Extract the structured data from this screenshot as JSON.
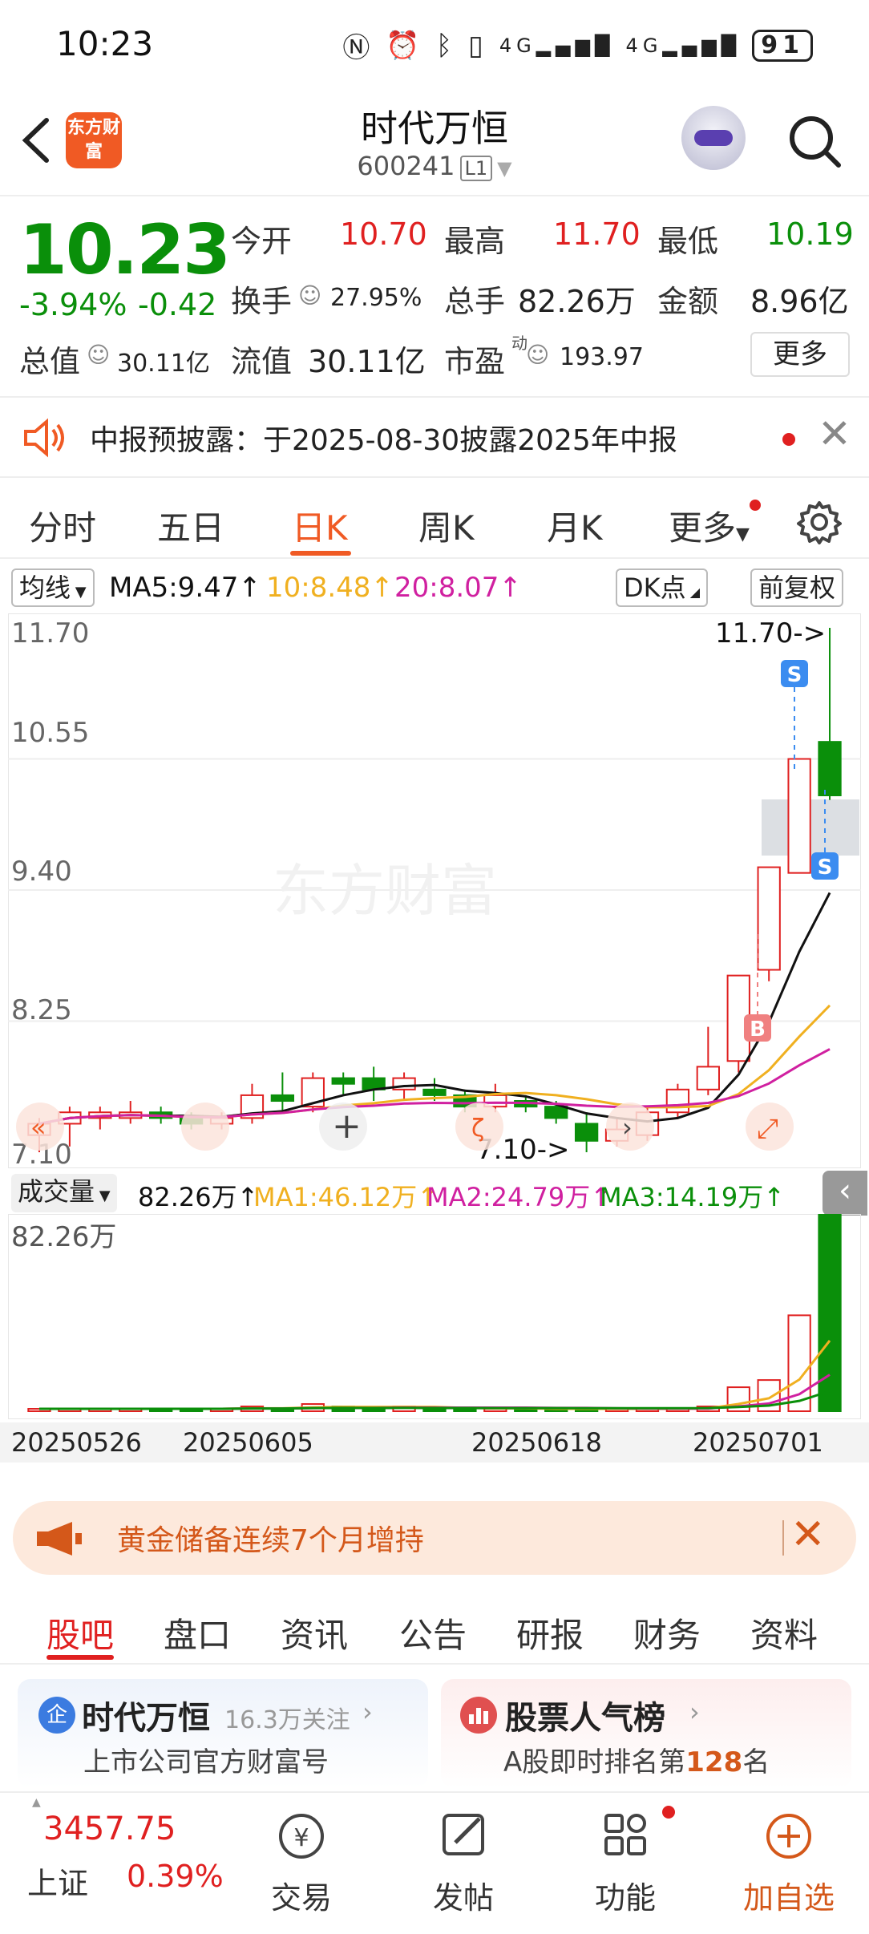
{
  "status": {
    "time": "10:23",
    "battery": "91"
  },
  "header": {
    "app_logo": "东方财富",
    "stock_name": "时代万恒",
    "stock_code": "600241",
    "level": "L1"
  },
  "quote": {
    "price": "10.23",
    "pct_change": "-3.94%",
    "abs_change": "-0.42",
    "open_label": "今开",
    "open": "10.70",
    "high_label": "最高",
    "high": "11.70",
    "low_label": "最低",
    "low": "10.19",
    "turnover_label": "换手",
    "turnover": "27.95%",
    "volume_label": "总手",
    "volume": "82.26万",
    "amount_label": "金额",
    "amount": "8.96亿",
    "mktcap_label": "总值",
    "mktcap": "30.11亿",
    "float_label": "流值",
    "float_cap": "30.11亿",
    "pe_label": "市盈",
    "pe_sup": "动",
    "pe": "193.97",
    "more": "更多"
  },
  "notice": {
    "text": "中报预披露：于2025-08-30披露2025年中报"
  },
  "chart_tabs": [
    "分时",
    "五日",
    "日K",
    "周K",
    "月K",
    "更多"
  ],
  "ma_row": {
    "selector": "均线",
    "ma5": "MA5:9.47↑",
    "ma10": "10:8.48↑",
    "ma20": "20:8.07↑",
    "dk": "DK点",
    "adjust": "前复权"
  },
  "kline": {
    "y_labels": [
      "11.70",
      "10.55",
      "9.40",
      "8.25",
      "7.10"
    ],
    "high_marker": "11.70->",
    "low_marker": "7.10->",
    "watermark": "东方财富",
    "sell_mark": "S",
    "buy_mark": "B"
  },
  "volume": {
    "selector": "成交量",
    "vol": "82.26万↑",
    "ma1": "MA1:46.12万↑",
    "ma2": "MA2:24.79万↑",
    "ma3": "MA3:14.19万↑",
    "axis_label": "82.26万"
  },
  "dates": [
    "20250526",
    "20250605",
    "20250618",
    "20250701"
  ],
  "banner": {
    "text": "黄金储备连续7个月增持"
  },
  "bottom_tabs": [
    "股吧",
    "盘口",
    "资讯",
    "公告",
    "研报",
    "财务",
    "资料"
  ],
  "card_left": {
    "title": "时代万恒",
    "follow": "16.3万关注",
    "sub": "上市公司官方财富号"
  },
  "card_right": {
    "title": "股票人气榜",
    "sub_pre": "A股即时排名第",
    "rank": "128",
    "sub_post": "名"
  },
  "bottom_nav": {
    "index_value": "3457.75",
    "index_name": "上证",
    "index_pct": "0.39%",
    "trade": "交易",
    "post": "发帖",
    "func": "功能",
    "add": "加自选"
  },
  "colors": {
    "up": "#e02020",
    "down": "#0a8f0a",
    "accent": "#f05a24",
    "ma5": "#111111",
    "ma10": "#f0b020",
    "ma20": "#d020a0"
  },
  "chart_data": {
    "type": "candlestick",
    "ylim": [
      7.1,
      11.7
    ],
    "candles": [
      {
        "o": 7.25,
        "c": 7.35,
        "h": 7.4,
        "l": 7.1
      },
      {
        "o": 7.35,
        "c": 7.45,
        "h": 7.5,
        "l": 7.15
      },
      {
        "o": 7.4,
        "c": 7.45,
        "h": 7.5,
        "l": 7.3
      },
      {
        "o": 7.4,
        "c": 7.45,
        "h": 7.55,
        "l": 7.35
      },
      {
        "o": 7.45,
        "c": 7.4,
        "h": 7.5,
        "l": 7.35
      },
      {
        "o": 7.4,
        "c": 7.35,
        "h": 7.45,
        "l": 7.3
      },
      {
        "o": 7.35,
        "c": 7.4,
        "h": 7.45,
        "l": 7.3
      },
      {
        "o": 7.4,
        "c": 7.6,
        "h": 7.7,
        "l": 7.35
      },
      {
        "o": 7.6,
        "c": 7.55,
        "h": 7.8,
        "l": 7.45
      },
      {
        "o": 7.5,
        "c": 7.75,
        "h": 7.8,
        "l": 7.45
      },
      {
        "o": 7.75,
        "c": 7.7,
        "h": 7.8,
        "l": 7.6
      },
      {
        "o": 7.75,
        "c": 7.65,
        "h": 7.85,
        "l": 7.55
      },
      {
        "o": 7.65,
        "c": 7.75,
        "h": 7.8,
        "l": 7.55
      },
      {
        "o": 7.65,
        "c": 7.6,
        "h": 7.75,
        "l": 7.55
      },
      {
        "o": 7.6,
        "c": 7.5,
        "h": 7.65,
        "l": 7.45
      },
      {
        "o": 7.5,
        "c": 7.6,
        "h": 7.7,
        "l": 7.45
      },
      {
        "o": 7.55,
        "c": 7.5,
        "h": 7.6,
        "l": 7.45
      },
      {
        "o": 7.5,
        "c": 7.4,
        "h": 7.55,
        "l": 7.35
      },
      {
        "o": 7.35,
        "c": 7.2,
        "h": 7.45,
        "l": 7.1
      },
      {
        "o": 7.2,
        "c": 7.3,
        "h": 7.4,
        "l": 7.15
      },
      {
        "o": 7.25,
        "c": 7.45,
        "h": 7.5,
        "l": 7.2
      },
      {
        "o": 7.45,
        "c": 7.65,
        "h": 7.7,
        "l": 7.4
      },
      {
        "o": 7.65,
        "c": 7.85,
        "h": 8.2,
        "l": 7.6
      },
      {
        "o": 7.9,
        "c": 8.65,
        "h": 8.65,
        "l": 7.8
      },
      {
        "o": 8.7,
        "c": 9.6,
        "h": 9.6,
        "l": 8.6
      },
      {
        "o": 9.55,
        "c": 10.55,
        "h": 10.55,
        "l": 9.6
      },
      {
        "o": 10.7,
        "c": 10.23,
        "h": 11.7,
        "l": 10.19
      }
    ],
    "volume_max": 82.26,
    "volume": [
      1,
      1,
      1,
      1,
      1,
      1,
      1,
      2,
      1,
      3,
      2,
      1,
      2,
      1,
      1,
      1,
      1,
      1,
      1,
      1,
      1,
      1,
      2,
      10,
      13,
      40,
      82.26
    ]
  }
}
